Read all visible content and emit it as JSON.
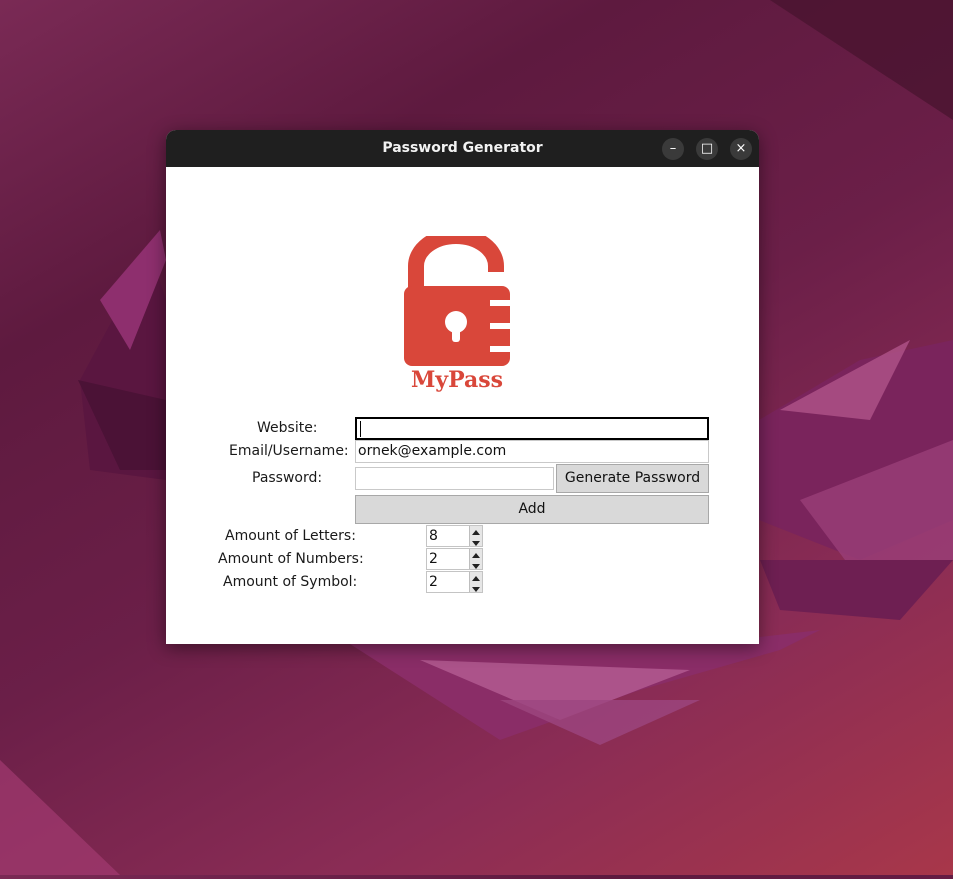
{
  "window": {
    "title": "Password Generator"
  },
  "titlebar_buttons": {
    "minimize": "–",
    "maximize": "□",
    "close": "×"
  },
  "logo": {
    "text": "MyPass",
    "color": "#d9473a"
  },
  "form": {
    "website_label": "Website:",
    "website_value": "",
    "email_label": "Email/Username:",
    "email_value": "ornek@example.com",
    "password_label": "Password:",
    "password_value": "",
    "generate_button": "Generate Password",
    "add_button": "Add",
    "letters_label": "Amount of Letters:",
    "letters_value": "8",
    "numbers_label": "Amount of Numbers:",
    "numbers_value": "2",
    "symbols_label": "Amount of Symbol:",
    "symbols_value": "2"
  },
  "colors": {
    "titlebar": "#1f1f1f",
    "button_bg": "#d9d9d9",
    "accent": "#d9473a"
  }
}
